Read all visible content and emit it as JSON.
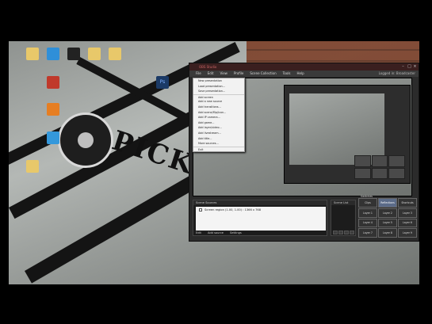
{
  "desktop": {
    "wallpaper_text": "PICK U",
    "icons": [
      {
        "icon": "folder-icon",
        "label": "",
        "color": "#e8c86a"
      },
      {
        "icon": "app-icon",
        "label": "",
        "color": "#2f8fd8"
      },
      {
        "icon": "terminal-icon",
        "label": "",
        "color": "#222222"
      },
      {
        "icon": "folder-icon",
        "label": "",
        "color": "#e8c86a"
      },
      {
        "icon": "folder-icon",
        "label": "",
        "color": "#e8c86a"
      },
      {
        "icon": "pdf-icon",
        "label": "",
        "color": "#c0392b"
      },
      {
        "icon": "media-icon",
        "label": "",
        "color": "#e67e22"
      },
      {
        "icon": "globe-icon",
        "label": "",
        "color": "#3498db"
      },
      {
        "icon": "folder-icon",
        "label": "",
        "color": "#e8c86a"
      },
      {
        "icon": "photoshop-icon",
        "label": "Ps",
        "color": "#1b3a66"
      }
    ]
  },
  "window": {
    "title": "OBS Studio",
    "menu": [
      "File",
      "Edit",
      "View",
      "Profile",
      "Scene Collection",
      "Tools",
      "Help"
    ],
    "menu_right": "Logged in: Broadcaster",
    "add_menu": [
      "New presentation",
      "Load presentation...",
      "Save presentation...",
      "Add screen",
      "Add a new source",
      "Add transitions...",
      "Add scene/flip/icon...",
      "Add IP camera...",
      "Add game...",
      "Add layer/video...",
      "Add livestream...",
      "Add title...",
      "More sources...",
      "Exit"
    ],
    "sources": {
      "title": "Scene Sources",
      "items": [
        {
          "label": "Screen region (1.00, 1.00) : 1366 x 768",
          "checked": true
        }
      ],
      "toolbar": [
        "Edit",
        "Add source",
        "Settings"
      ]
    },
    "scenes": {
      "title": "Scene List"
    },
    "layout_buttons": {
      "title": "Switches",
      "labels": [
        "Clips",
        "Reflections",
        "Shortcuts",
        "Layer 1",
        "Layer 2",
        "Layer 3",
        "Layer 4",
        "Layer 5",
        "Layer 6",
        "Layer 7",
        "Layer 8",
        "Layer 9"
      ],
      "active_index": 1
    }
  }
}
